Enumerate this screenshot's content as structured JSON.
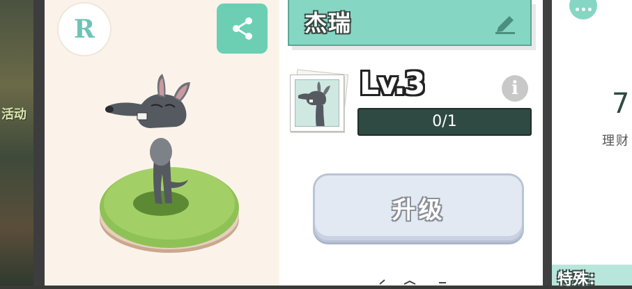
{
  "background": {
    "side_text": "活动"
  },
  "character": {
    "rarity": "R",
    "name": "杰瑞",
    "level": "Lv.3",
    "progress_text": "0/1",
    "progress_value": 0.0
  },
  "actions": {
    "upgrade_label": "升级"
  },
  "icons": {
    "share": "share-icon",
    "edit": "pencil-icon",
    "info": "info-icon",
    "more": "more-dots-icon"
  },
  "right_panel": {
    "value": "7",
    "label": "理财",
    "special_label": "特殊："
  },
  "colors": {
    "accent": "#6ccfb4",
    "banner": "#86d6c4",
    "progress_bg": "#2f4a42",
    "panel_bg": "#fbf3ea",
    "button_bg": "#e2e9f3"
  }
}
